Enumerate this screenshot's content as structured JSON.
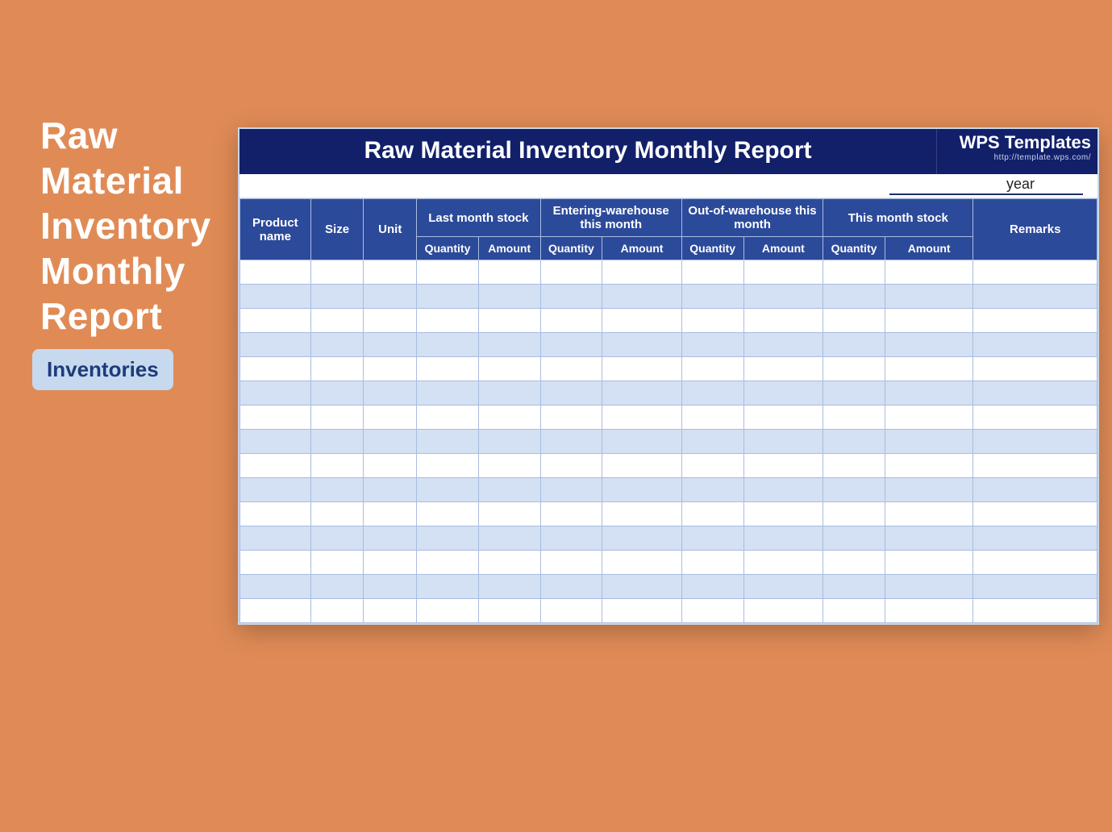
{
  "side": {
    "title_line1": "Raw",
    "title_line2": "Material",
    "title_line3": "Inventory",
    "title_line4": "Monthly",
    "title_line5": "Report",
    "tag": "Inventories"
  },
  "sheet": {
    "title": "Raw Material Inventory Monthly Report",
    "brand": "WPS Templates",
    "brand_url": "http://template.wps.com/",
    "year_label": "year",
    "headers": {
      "product_name": "Product name",
      "size": "Size",
      "unit": "Unit",
      "last_month": "Last month stock",
      "entering": "Entering-warehouse this month",
      "outof": "Out-of-warehouse this month",
      "this_month": "This month stock",
      "remarks": "Remarks",
      "quantity": "Quantity",
      "amount": "Amount"
    },
    "rows": [
      {
        "product_name": "",
        "size": "",
        "unit": "",
        "lm_qty": "",
        "lm_amt": "",
        "en_qty": "",
        "en_amt": "",
        "out_qty": "",
        "out_amt": "",
        "tm_qty": "",
        "tm_amt": "",
        "remarks": ""
      },
      {
        "product_name": "",
        "size": "",
        "unit": "",
        "lm_qty": "",
        "lm_amt": "",
        "en_qty": "",
        "en_amt": "",
        "out_qty": "",
        "out_amt": "",
        "tm_qty": "",
        "tm_amt": "",
        "remarks": ""
      },
      {
        "product_name": "",
        "size": "",
        "unit": "",
        "lm_qty": "",
        "lm_amt": "",
        "en_qty": "",
        "en_amt": "",
        "out_qty": "",
        "out_amt": "",
        "tm_qty": "",
        "tm_amt": "",
        "remarks": ""
      },
      {
        "product_name": "",
        "size": "",
        "unit": "",
        "lm_qty": "",
        "lm_amt": "",
        "en_qty": "",
        "en_amt": "",
        "out_qty": "",
        "out_amt": "",
        "tm_qty": "",
        "tm_amt": "",
        "remarks": ""
      },
      {
        "product_name": "",
        "size": "",
        "unit": "",
        "lm_qty": "",
        "lm_amt": "",
        "en_qty": "",
        "en_amt": "",
        "out_qty": "",
        "out_amt": "",
        "tm_qty": "",
        "tm_amt": "",
        "remarks": ""
      },
      {
        "product_name": "",
        "size": "",
        "unit": "",
        "lm_qty": "",
        "lm_amt": "",
        "en_qty": "",
        "en_amt": "",
        "out_qty": "",
        "out_amt": "",
        "tm_qty": "",
        "tm_amt": "",
        "remarks": ""
      },
      {
        "product_name": "",
        "size": "",
        "unit": "",
        "lm_qty": "",
        "lm_amt": "",
        "en_qty": "",
        "en_amt": "",
        "out_qty": "",
        "out_amt": "",
        "tm_qty": "",
        "tm_amt": "",
        "remarks": ""
      },
      {
        "product_name": "",
        "size": "",
        "unit": "",
        "lm_qty": "",
        "lm_amt": "",
        "en_qty": "",
        "en_amt": "",
        "out_qty": "",
        "out_amt": "",
        "tm_qty": "",
        "tm_amt": "",
        "remarks": ""
      },
      {
        "product_name": "",
        "size": "",
        "unit": "",
        "lm_qty": "",
        "lm_amt": "",
        "en_qty": "",
        "en_amt": "",
        "out_qty": "",
        "out_amt": "",
        "tm_qty": "",
        "tm_amt": "",
        "remarks": ""
      },
      {
        "product_name": "",
        "size": "",
        "unit": "",
        "lm_qty": "",
        "lm_amt": "",
        "en_qty": "",
        "en_amt": "",
        "out_qty": "",
        "out_amt": "",
        "tm_qty": "",
        "tm_amt": "",
        "remarks": ""
      },
      {
        "product_name": "",
        "size": "",
        "unit": "",
        "lm_qty": "",
        "lm_amt": "",
        "en_qty": "",
        "en_amt": "",
        "out_qty": "",
        "out_amt": "",
        "tm_qty": "",
        "tm_amt": "",
        "remarks": ""
      },
      {
        "product_name": "",
        "size": "",
        "unit": "",
        "lm_qty": "",
        "lm_amt": "",
        "en_qty": "",
        "en_amt": "",
        "out_qty": "",
        "out_amt": "",
        "tm_qty": "",
        "tm_amt": "",
        "remarks": ""
      },
      {
        "product_name": "",
        "size": "",
        "unit": "",
        "lm_qty": "",
        "lm_amt": "",
        "en_qty": "",
        "en_amt": "",
        "out_qty": "",
        "out_amt": "",
        "tm_qty": "",
        "tm_amt": "",
        "remarks": ""
      },
      {
        "product_name": "",
        "size": "",
        "unit": "",
        "lm_qty": "",
        "lm_amt": "",
        "en_qty": "",
        "en_amt": "",
        "out_qty": "",
        "out_amt": "",
        "tm_qty": "",
        "tm_amt": "",
        "remarks": ""
      },
      {
        "product_name": "",
        "size": "",
        "unit": "",
        "lm_qty": "",
        "lm_amt": "",
        "en_qty": "",
        "en_amt": "",
        "out_qty": "",
        "out_amt": "",
        "tm_qty": "",
        "tm_amt": "",
        "remarks": ""
      }
    ]
  }
}
